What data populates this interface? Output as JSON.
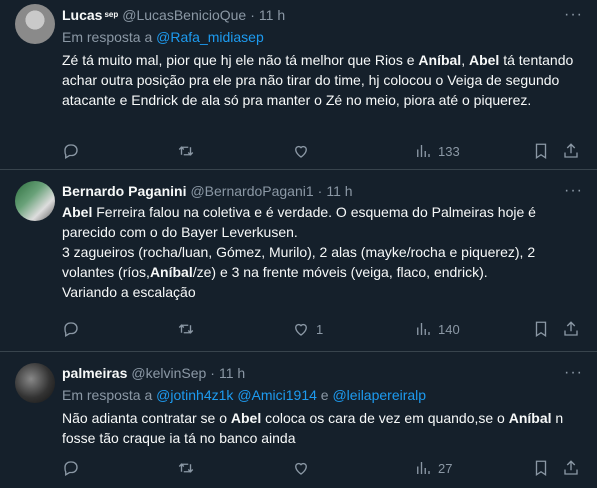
{
  "tweets": [
    {
      "name": "Lucas",
      "badge": "sep",
      "handle": "@LucasBenicioQue",
      "dot": "·",
      "time": "11 h",
      "reply_prefix": "Em resposta a",
      "mentions": [
        "@Rafa_midiasep"
      ],
      "text_parts": [
        {
          "t": "Zé tá muito mal, pior que hj ele não tá melhor que Rios e ",
          "b": false
        },
        {
          "t": "Aníbal",
          "b": true
        },
        {
          "t": ", ",
          "b": false
        },
        {
          "t": "Abel",
          "b": true
        },
        {
          "t": " tá tentando achar outra posição pra ele pra não tirar do time, hj colocou o Veiga de segundo atacante e Endrick de ala só pra manter o Zé no meio, piora até o piquerez.",
          "b": false
        }
      ],
      "replies": "",
      "retweets": "",
      "likes": "",
      "views": "133"
    },
    {
      "name": "Bernardo Paganini",
      "handle": "@BernardoPagani1",
      "dot": "·",
      "time": "11 h",
      "text_lines": [
        [
          {
            "t": "Abel",
            "b": true
          },
          {
            "t": " Ferreira falou na coletiva e é verdade. O esquema do Palmeiras hoje é parecido com o do Bayer Leverkusen.",
            "b": false
          }
        ],
        [
          {
            "t": "3 zagueiros (rocha/luan, Gómez, Murilo), 2 alas (mayke/rocha e piquerez), 2 volantes (ríos,",
            "b": false
          },
          {
            "t": "Aníbal",
            "b": true
          },
          {
            "t": "/ze) e 3 na frente móveis (veiga, flaco, endrick).",
            "b": false
          }
        ],
        [
          {
            "t": "Variando a escalação",
            "b": false
          }
        ]
      ],
      "replies": "",
      "retweets": "",
      "likes": "1",
      "views": "140"
    },
    {
      "name": "palmeiras",
      "handle": "@kelvinSep",
      "dot": "·",
      "time": "11 h",
      "reply_prefix": "Em resposta a",
      "mentions": [
        "@jotinh4z1k",
        "@Amici1914",
        "@leilapereiralp"
      ],
      "mention_joiner": "e",
      "text_parts": [
        {
          "t": "Não adianta contratar se o ",
          "b": false
        },
        {
          "t": "Abel",
          "b": true
        },
        {
          "t": " coloca os cara de vez em quando,se o ",
          "b": false
        },
        {
          "t": "Aníbal",
          "b": true
        },
        {
          "t": " n fosse tão craque ia tá no banco ainda",
          "b": false
        }
      ],
      "replies": "",
      "retweets": "",
      "likes": "",
      "views": "27"
    }
  ],
  "icons": {
    "more": "more-horizontal-icon",
    "reply": "reply-icon",
    "retweet": "retweet-icon",
    "like": "heart-icon",
    "views": "views-chart-icon",
    "bookmark": "bookmark-icon",
    "share": "share-icon"
  },
  "colors": {
    "background": "#15202b",
    "text": "#f7f9f9",
    "muted": "#8b98a5",
    "link": "#1d9bf0",
    "divider": "#38444d"
  }
}
